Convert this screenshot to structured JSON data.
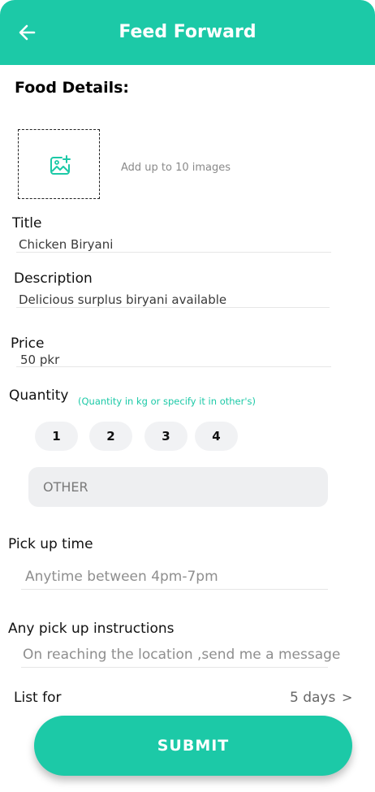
{
  "header": {
    "title": "Feed Forward"
  },
  "section_title": "Food Details:",
  "upload": {
    "hint": "Add up to 10 images"
  },
  "title_field": {
    "label": "Title",
    "value": "Chicken Biryani"
  },
  "description_field": {
    "label": "Description",
    "value": "Delicious surplus biryani available"
  },
  "price_field": {
    "label": "Price",
    "value": "50 pkr"
  },
  "quantity": {
    "label": "Quantity",
    "hint": "(Quantity in kg or specify it in other's)",
    "options": [
      "1",
      "2",
      "3",
      "4"
    ],
    "other_placeholder": "OTHER"
  },
  "pickup_time": {
    "label": "Pick up time",
    "placeholder": "Anytime between 4pm-7pm"
  },
  "instructions": {
    "label": "Any pick up instructions",
    "placeholder": "On reaching the location ,send me a message"
  },
  "list_for": {
    "label": "List for",
    "value": "5 days",
    "chevron": ">"
  },
  "submit_label": "SUBMIT",
  "colors": {
    "accent": "#1cc9a7",
    "chip_bg": "#f1f2f4",
    "field_bg": "#eeeff1"
  },
  "icons": {
    "back": "arrow-left-icon",
    "upload": "image-plus-icon"
  }
}
